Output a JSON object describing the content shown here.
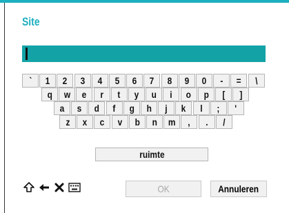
{
  "dialog": {
    "title": "Site",
    "input_value": ""
  },
  "keyboard": {
    "rows": [
      [
        "`",
        "1",
        "2",
        "3",
        "4",
        "5",
        "6",
        "7",
        "8",
        "9",
        "0",
        "-",
        "=",
        "\\"
      ],
      [
        "q",
        "w",
        "e",
        "r",
        "t",
        "y",
        "u",
        "i",
        "o",
        "p",
        "[",
        "]"
      ],
      [
        "a",
        "s",
        "d",
        "f",
        "g",
        "h",
        "j",
        "k",
        "l",
        ";",
        "'"
      ],
      [
        "z",
        "x",
        "c",
        "v",
        "b",
        "n",
        "m",
        ",",
        ".",
        "/"
      ]
    ],
    "space_label": "ruimte"
  },
  "toolbar": {
    "icons": [
      "shift-icon",
      "backspace-icon",
      "clear-icon",
      "keyboard-icon"
    ]
  },
  "buttons": {
    "ok_label": "OK",
    "cancel_label": "Annuleren"
  },
  "colors": {
    "accent": "#1cafc0",
    "input_bg": "#13a3a6",
    "key_bg": "#f1f1f1",
    "disabled_text": "#a8a8a8"
  }
}
